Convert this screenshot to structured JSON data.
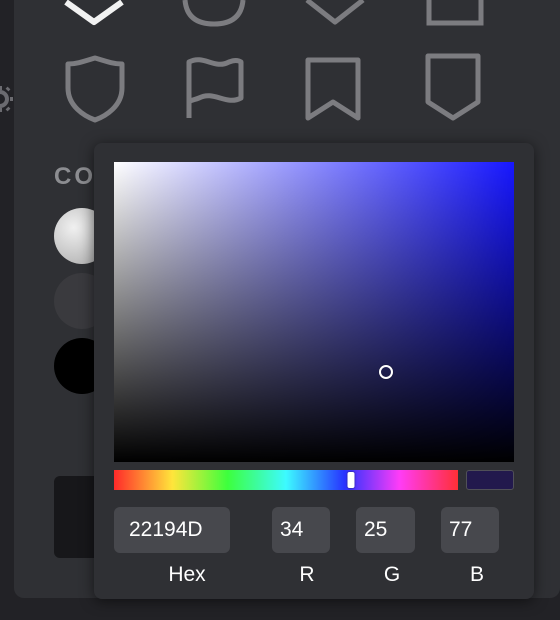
{
  "icons": {
    "row_top": [
      "shield-pointed-icon",
      "circle-badge-icon",
      "diamond-icon",
      "square-badge-icon"
    ],
    "row_bottom": [
      "shield-icon",
      "flag-icon",
      "bookmark-icon",
      "pennant-icon"
    ]
  },
  "section": {
    "label": "CO"
  },
  "swatches": [
    "#d4d4d4",
    "#3a3a3e",
    "#000000"
  ],
  "picker": {
    "hex_value": "22194D",
    "r_value": "34",
    "g_value": "25",
    "b_value": "77",
    "hex_label": "Hex",
    "r_label": "R",
    "g_label": "G",
    "b_label": "B",
    "preview_color": "#22194D",
    "hue_fraction": 0.69,
    "saturation": 0.68,
    "value": 0.3,
    "hue_color": "#1717ff"
  }
}
